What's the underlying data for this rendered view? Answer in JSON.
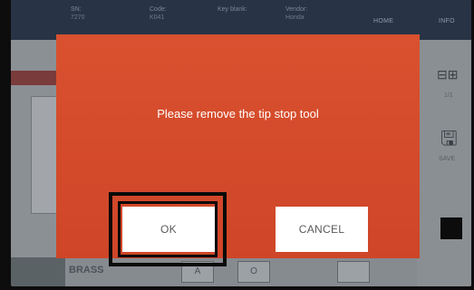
{
  "topbar": {
    "columns": [
      {
        "label": "SN:",
        "value": "7270"
      },
      {
        "label": "Code:",
        "value": "K041"
      },
      {
        "label": "Key blank:",
        "value": ""
      },
      {
        "label": "Vendor:",
        "value": "Honda"
      }
    ],
    "nav": {
      "home": "HOME",
      "info": "INFO"
    }
  },
  "right_panel": {
    "page": "1/1",
    "save": "SAVE"
  },
  "bottom_bar": {
    "material": "BRASS",
    "key_a": "A",
    "key_o": "O"
  },
  "modal": {
    "message": "Please remove the tip stop tool",
    "ok_label": "OK",
    "cancel_label": "CANCEL",
    "color": "#d44a30"
  }
}
